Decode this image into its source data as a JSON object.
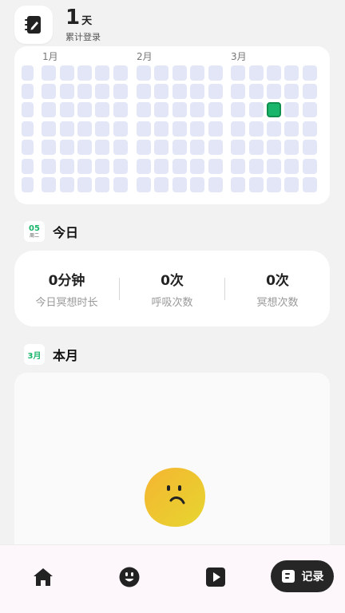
{
  "header": {
    "app_icon": "notebook-pen-icon",
    "login_days": "1",
    "login_unit": "天",
    "login_label": "累计登录"
  },
  "heatmap": {
    "months": [
      "1月",
      "2月",
      "3月"
    ],
    "active_days": [
      {
        "month": "3月",
        "week": 2,
        "weekday": 2
      }
    ]
  },
  "today": {
    "badge_day": "05",
    "badge_weekday": "周二",
    "title": "今日",
    "stats": [
      {
        "value": "0分钟",
        "label": "今日冥想时长"
      },
      {
        "value": "0次",
        "label": "呼吸次数"
      },
      {
        "value": "0次",
        "label": "冥想次数"
      }
    ]
  },
  "month": {
    "badge": "3月",
    "title": "本月",
    "mood": "sad-face-icon"
  },
  "nav": {
    "items": [
      "home-icon",
      "smile-icon",
      "play-icon"
    ],
    "record_label": "记录",
    "record_icon": "note-icon"
  },
  "colors": {
    "accent": "#18b56a",
    "cell_empty": "#e3e6f6",
    "mood_yellow": "#f5c22e"
  }
}
